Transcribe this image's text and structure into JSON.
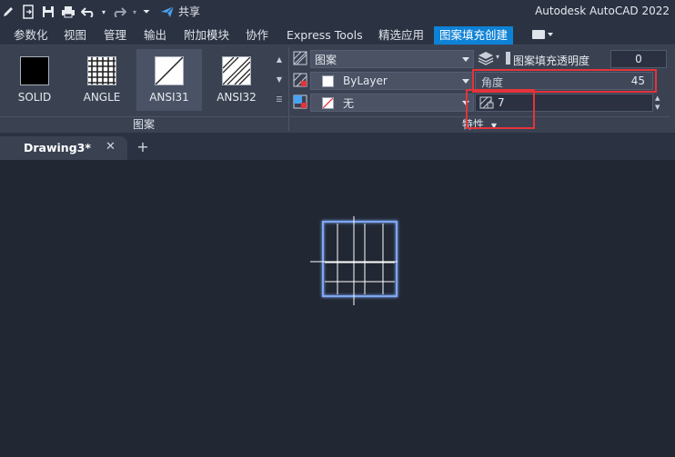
{
  "titlebar": {
    "share_label": "共享",
    "app_title": "Autodesk AutoCAD 2022"
  },
  "ribbon_tabs": [
    {
      "label": "参数化"
    },
    {
      "label": "视图"
    },
    {
      "label": "管理"
    },
    {
      "label": "输出"
    },
    {
      "label": "附加模块"
    },
    {
      "label": "协作"
    },
    {
      "label": "Express Tools"
    },
    {
      "label": "精选应用"
    },
    {
      "label": "图案填充创建",
      "active": true
    }
  ],
  "pattern_panel": {
    "title": "图案",
    "swatches": [
      {
        "label": "SOLID"
      },
      {
        "label": "ANGLE"
      },
      {
        "label": "ANSI31",
        "selected": true
      },
      {
        "label": "ANSI32"
      }
    ]
  },
  "properties_panel": {
    "title": "特性",
    "hatch_type": "图案",
    "hatch_color": "ByLayer",
    "background_color": "无",
    "transparency_label": "图案填充透明度",
    "transparency_value": "0",
    "angle_label": "角度",
    "angle_value": "45",
    "scale_value": "7"
  },
  "document": {
    "tab_name": "Drawing3*",
    "close_glyph": "✕",
    "new_tab_glyph": "+"
  },
  "colors": {
    "accent": "#0e82d6",
    "highlight": "#e5333b",
    "canvas": "#212733",
    "selection": "#7ea6f2"
  }
}
